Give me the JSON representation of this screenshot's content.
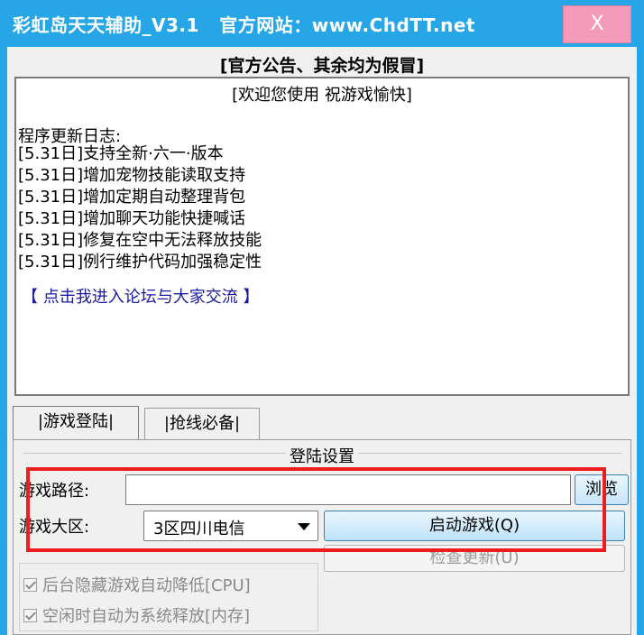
{
  "window": {
    "title": "彩虹岛天天辅助_V3.1   官方网站：www.ChdTT.net",
    "close_label": "X"
  },
  "notice": {
    "title": "[官方公告、其余均为假冒]",
    "welcome": "[欢迎您使用 祝游戏愉快]",
    "log_header": "程序更新日志:",
    "log_lines": [
      "[5.31日]支持全新·六一·版本",
      "[5.31日]增加宠物技能读取支持",
      "[5.31日]增加定期自动整理背包",
      "[5.31日]增加聊天功能快捷喊话",
      "[5.31日]修复在空中无法释放技能",
      "[5.31日]例行维护代码加强稳定性"
    ],
    "forum_link": "【 点击我进入论坛与大家交流 】"
  },
  "tabs": [
    {
      "label": "|游戏登陆|"
    },
    {
      "label": "|抢线必备|"
    }
  ],
  "login": {
    "group_title": "登陆设置",
    "path_label": "游戏路径:",
    "path_value": "",
    "browse_label": "浏览",
    "region_label": "游戏大区:",
    "region_value": "3区四川电信",
    "start_label": "启动游戏(Q)",
    "check_update_label": "检查更新(U)",
    "options": [
      {
        "label": "后台隐藏游戏自动降低[CPU]",
        "checked": true
      },
      {
        "label": "空闲时自动为系统释放[内存]",
        "checked": true
      }
    ]
  },
  "colors": {
    "titlebar": "#26a6e6",
    "close": "#f49bb9",
    "highlight": "#ee1d1d",
    "link": "#1a1aa0"
  }
}
